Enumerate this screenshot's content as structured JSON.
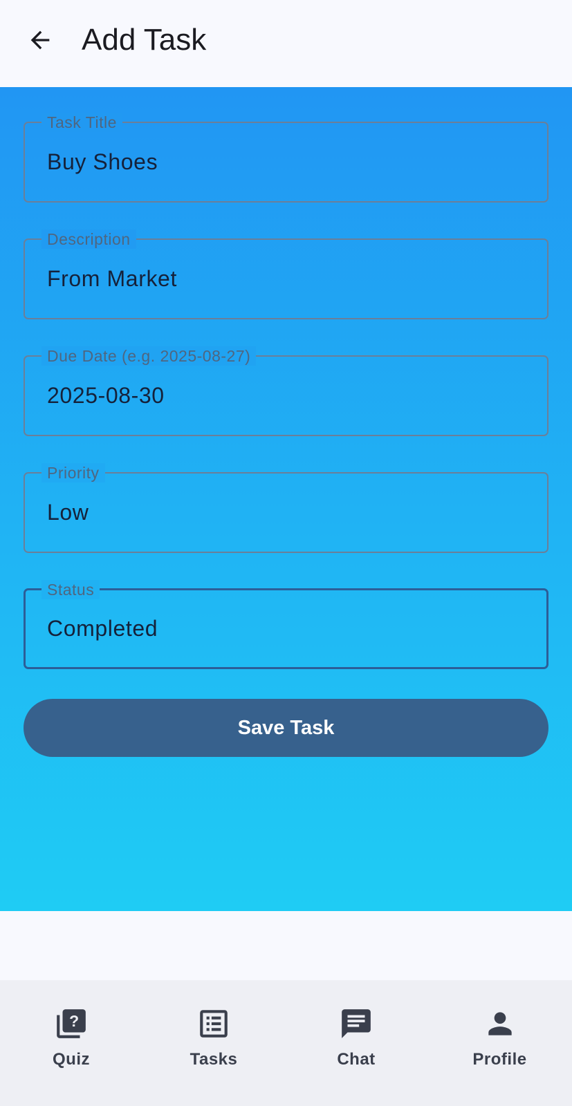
{
  "header": {
    "title": "Add Task",
    "back_icon": "arrow-left-icon"
  },
  "form": {
    "fields": [
      {
        "label": "Task Title",
        "value": "Buy Shoes"
      },
      {
        "label": "Description",
        "value": "From Market"
      },
      {
        "label": "Due Date (e.g. 2025-08-27)",
        "value": "2025-08-30"
      },
      {
        "label": "Priority",
        "value": "Low"
      },
      {
        "label": "Status",
        "value": "Completed",
        "focused": true
      }
    ],
    "save_label": "Save Task"
  },
  "bottom_nav": {
    "items": [
      {
        "label": "Quiz",
        "icon": "quiz-icon"
      },
      {
        "label": "Tasks",
        "icon": "tasks-list-icon"
      },
      {
        "label": "Chat",
        "icon": "chat-icon"
      },
      {
        "label": "Profile",
        "icon": "person-icon"
      }
    ]
  },
  "colors": {
    "gradient_top": "#2196f3",
    "gradient_bottom": "#1fccf4",
    "button": "#37618d",
    "nav_background": "#eeeff4"
  }
}
